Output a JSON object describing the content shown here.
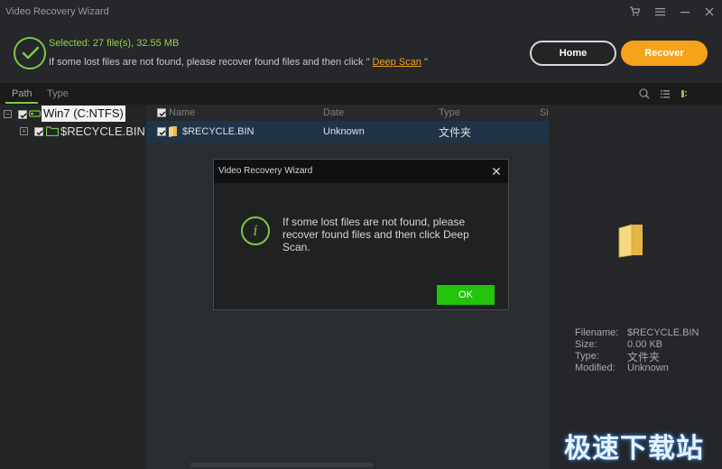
{
  "window": {
    "title": "Video Recovery Wizard"
  },
  "header": {
    "selected": "Selected: 27 file(s), 32.55 MB",
    "hint_before": "If some lost files are not found, please recover found files and then click \"",
    "deep_scan": "Deep Scan",
    "hint_after": "\"",
    "home_label": "Home",
    "recover_label": "Recover"
  },
  "tabs": [
    {
      "label": "Path"
    },
    {
      "label": "Type"
    }
  ],
  "tree": {
    "drive": "Win7 (C:NTFS)",
    "folder": "$RECYCLE.BIN"
  },
  "list": {
    "columns": {
      "name": "Name",
      "date": "Date",
      "type": "Type",
      "size": "Si"
    },
    "row": {
      "name": "$RECYCLE.BIN",
      "date": "Unknown",
      "type": "文件夹"
    }
  },
  "preview": {
    "filename_k": "Filename:",
    "filename_v": "$RECYCLE.BIN",
    "size_k": "Size:",
    "size_v": "0.00 KB",
    "type_k": "Type:",
    "type_v": "文件夹",
    "modified_k": "Modified:",
    "modified_v": "Unknown"
  },
  "dialog": {
    "title": "Video Recovery Wizard",
    "icon_glyph": "i",
    "message": "If some lost files are not found, please recover found files and then click Deep Scan.",
    "ok_label": "OK"
  },
  "watermark": "极速下载站",
  "colors": {
    "accent_green": "#7ac943",
    "accent_orange": "#f7a21b",
    "ok_green": "#22c40c"
  }
}
